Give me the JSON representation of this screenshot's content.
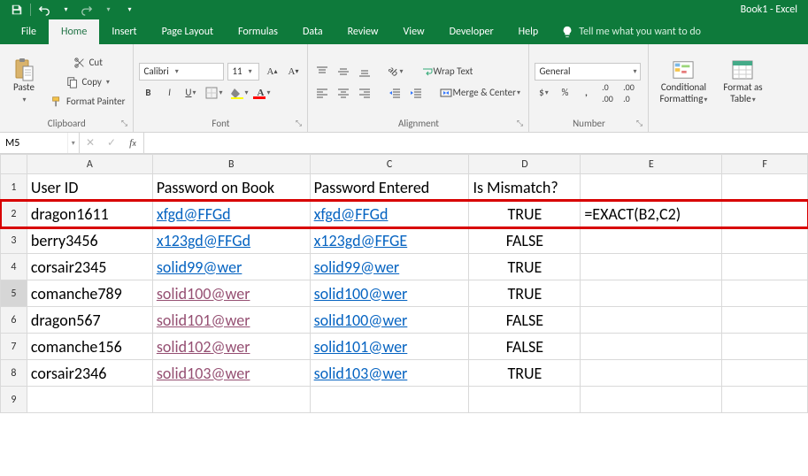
{
  "title": "Book1 - Excel",
  "qat": {
    "save": "save",
    "undo": "undo",
    "redo": "redo"
  },
  "tabs": [
    "File",
    "Home",
    "Insert",
    "Page Layout",
    "Formulas",
    "Data",
    "Review",
    "View",
    "Developer",
    "Help"
  ],
  "active_tab": "Home",
  "tellme_placeholder": "Tell me what you want to do",
  "ribbon": {
    "clipboard": {
      "label": "Clipboard",
      "paste": "Paste",
      "cut": "Cut",
      "copy": "Copy",
      "format_painter": "Format Painter"
    },
    "font": {
      "label": "Font",
      "name": "Calibri",
      "size": "11"
    },
    "alignment": {
      "label": "Alignment",
      "wrap": "Wrap Text",
      "merge": "Merge & Center"
    },
    "number": {
      "label": "Number",
      "format": "General"
    },
    "styles": {
      "cond": "Conditional Formatting",
      "table": "Format as Table"
    }
  },
  "namebox": "M5",
  "formula": "",
  "columns": [
    "A",
    "B",
    "C",
    "D",
    "E",
    "F"
  ],
  "headers": {
    "A": "User ID",
    "B": "Password on Book",
    "C": "Password Entered",
    "D": "Is Mismatch?"
  },
  "rows": [
    {
      "n": 1,
      "A": "User ID",
      "B": "Password on Book",
      "C": "Password Entered",
      "D": "Is Mismatch?",
      "E": "",
      "Blink": false,
      "Clink": false,
      "Bv": false,
      "Cv": false,
      "Dcenter": false
    },
    {
      "n": 2,
      "A": "dragon1611",
      "B": "xfgd@FFGd",
      "C": "xfgd@FFGd",
      "D": "TRUE",
      "E": "=EXACT(B2,C2)",
      "Blink": true,
      "Clink": true,
      "Bv": false,
      "Cv": false,
      "Dcenter": true,
      "highlight": true
    },
    {
      "n": 3,
      "A": "berry3456",
      "B": "x123gd@FFGd",
      "C": "x123gd@FFGE",
      "D": "FALSE",
      "E": "",
      "Blink": true,
      "Clink": true,
      "Bv": false,
      "Cv": false,
      "Dcenter": true
    },
    {
      "n": 4,
      "A": "corsair2345",
      "B": "solid99@wer",
      "C": "solid99@wer",
      "D": "TRUE",
      "E": "",
      "Blink": true,
      "Clink": true,
      "Bv": false,
      "Cv": false,
      "Dcenter": true
    },
    {
      "n": 5,
      "A": "comanche789",
      "B": "solid100@wer",
      "C": "solid100@wer",
      "D": "TRUE",
      "E": "",
      "Blink": true,
      "Clink": true,
      "Bv": true,
      "Cv": false,
      "Dcenter": true,
      "selrow": true
    },
    {
      "n": 6,
      "A": "dragon567",
      "B": "solid101@wer",
      "C": "solid100@wer",
      "D": "FALSE",
      "E": "",
      "Blink": true,
      "Clink": true,
      "Bv": true,
      "Cv": false,
      "Dcenter": true
    },
    {
      "n": 7,
      "A": "comanche156",
      "B": "solid102@wer",
      "C": "solid101@wer",
      "D": "FALSE",
      "E": "",
      "Blink": true,
      "Clink": true,
      "Bv": true,
      "Cv": false,
      "Dcenter": true
    },
    {
      "n": 8,
      "A": "corsair2346",
      "B": "solid103@wer",
      "C": "solid103@wer",
      "D": "TRUE",
      "E": "",
      "Blink": true,
      "Clink": true,
      "Bv": true,
      "Cv": false,
      "Dcenter": true
    },
    {
      "n": 9,
      "A": "",
      "B": "",
      "C": "",
      "D": "",
      "E": "",
      "Blink": false,
      "Clink": false,
      "Bv": false,
      "Cv": false,
      "Dcenter": false
    }
  ]
}
